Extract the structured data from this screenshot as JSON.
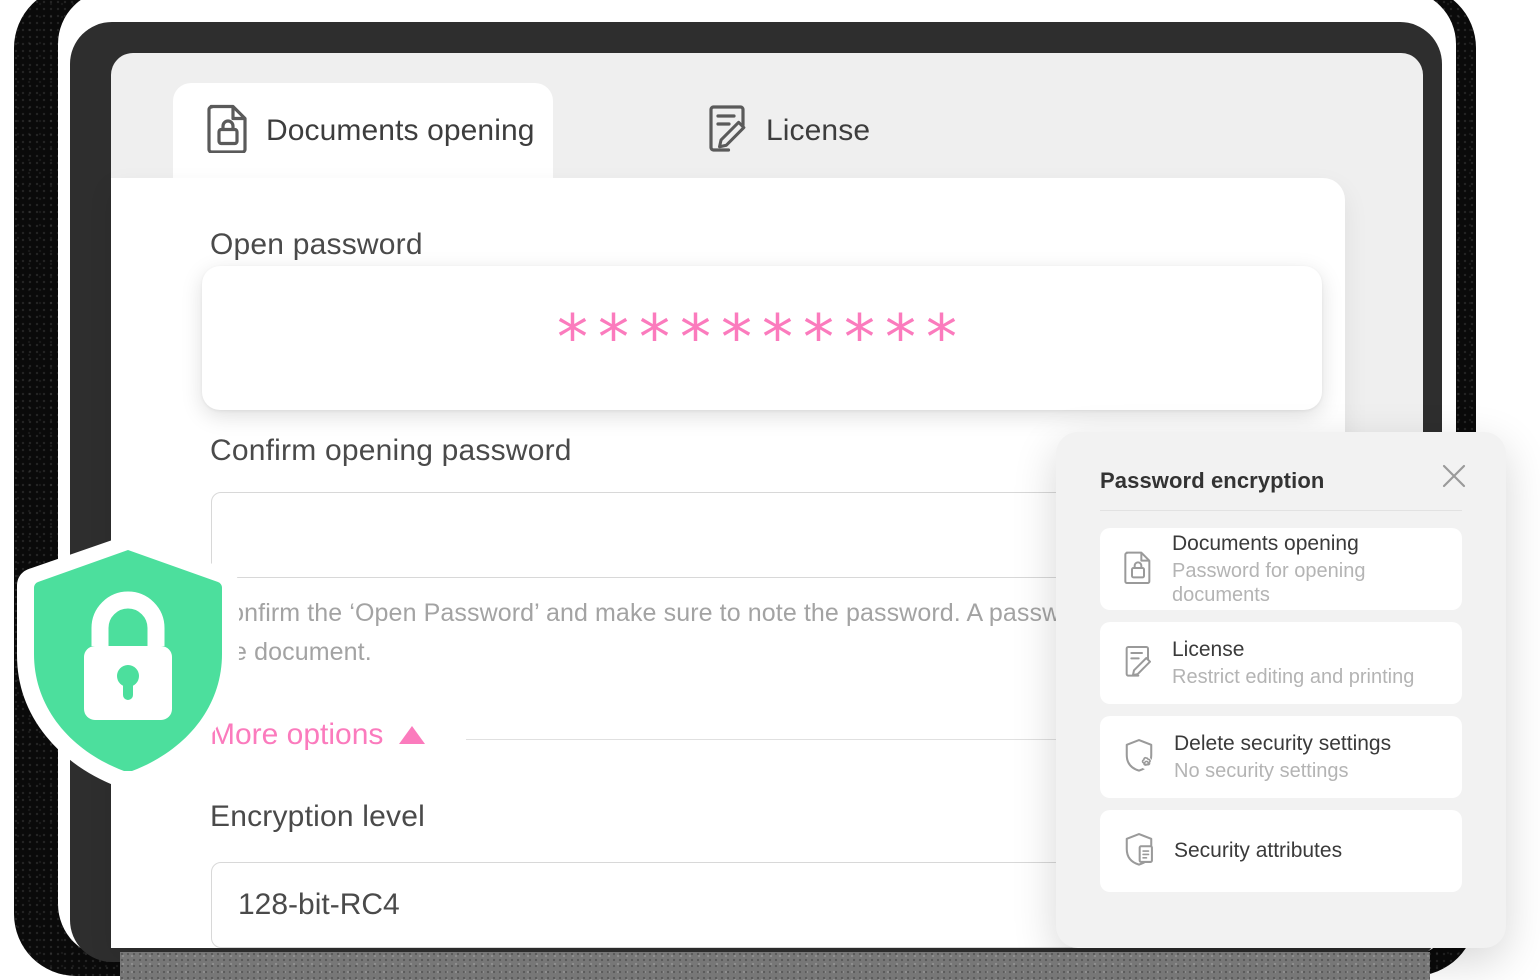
{
  "window": {
    "tabs": [
      {
        "id": "documents-opening",
        "label": "Documents opening",
        "icon": "document-lock-icon",
        "active": true
      },
      {
        "id": "license",
        "label": "License",
        "icon": "document-pencil-icon",
        "active": false
      }
    ]
  },
  "form": {
    "open_password": {
      "label": "Open password",
      "value": "**********",
      "mask_count": 10,
      "color": "#fb7bbd"
    },
    "confirm_password": {
      "label": "Confirm opening password",
      "value": "",
      "placeholder": ""
    },
    "help_text": "Confirm the ‘Open Password’ and make sure to note the password. A password is needed to open the document.",
    "more_options": {
      "label": "More options",
      "icon": "caret-up-icon",
      "expanded": true,
      "color": "#fb7bbd"
    },
    "encryption_level": {
      "label": "Encryption level",
      "value": "128-bit-RC4"
    }
  },
  "badge": {
    "icon": "shield-lock-icon",
    "shield_color": "#4cdf9d",
    "lock_color": "#ffffff"
  },
  "popup": {
    "title": "Password encryption",
    "close_icon": "close-icon",
    "items": [
      {
        "icon": "document-lock-icon",
        "title": "Documents opening",
        "subtitle": "Password for opening documents"
      },
      {
        "icon": "document-pencil-icon",
        "title": "License",
        "subtitle": "Restrict editing and printing"
      },
      {
        "icon": "shield-gear-icon",
        "title": "Delete security settings",
        "subtitle": "No security settings"
      },
      {
        "icon": "shield-document-icon",
        "title": "Security attributes",
        "subtitle": ""
      }
    ]
  }
}
